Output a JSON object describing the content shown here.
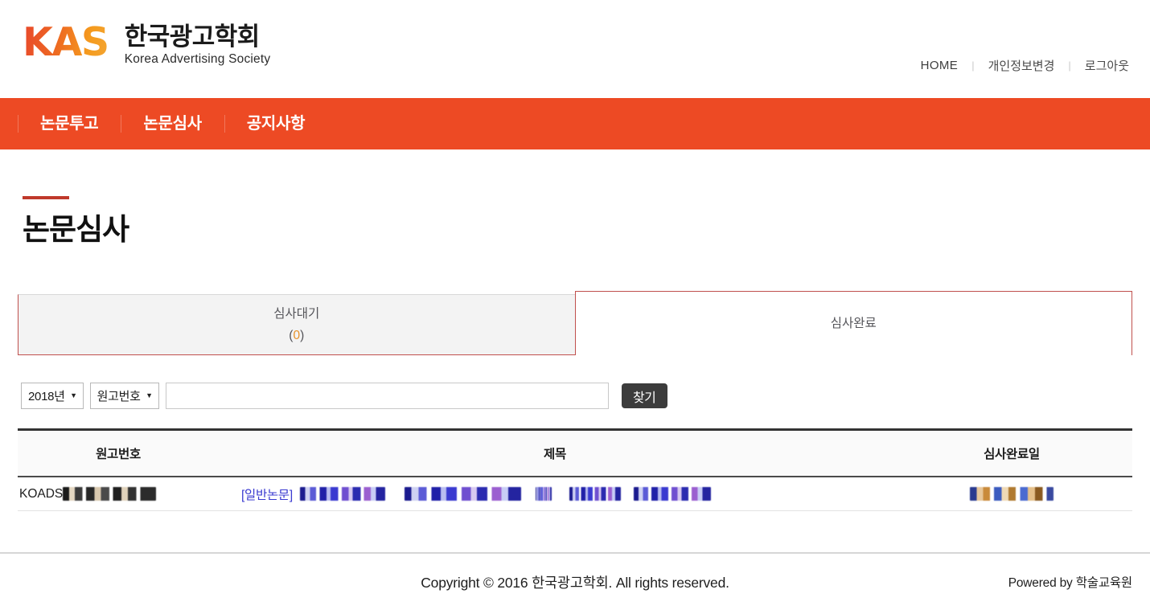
{
  "site": {
    "logo_mark": "KAS",
    "logo_name_ko": "한국광고학회",
    "logo_name_en": "Korea Advertising Society"
  },
  "top_nav": {
    "home": "HOME",
    "separator": "|",
    "profile": "개인정보변경",
    "logout": "로그아웃"
  },
  "main_nav": {
    "items": [
      {
        "label": "논문투고"
      },
      {
        "label": "논문심사"
      },
      {
        "label": "공지사항"
      }
    ]
  },
  "page": {
    "title": "논문심사"
  },
  "tabs": [
    {
      "label": "심사대기",
      "count_open": "(",
      "count": "0",
      "count_close": ")",
      "active": false
    },
    {
      "label": "심사완료",
      "active": true
    }
  ],
  "search": {
    "year_value": "2018년",
    "field_value": "원고번호",
    "caret": "▼",
    "keyword_value": "",
    "keyword_placeholder": "",
    "button_label": "찾기"
  },
  "table": {
    "headers": {
      "no": "원고번호",
      "title": "제목",
      "date": "심사완료일"
    },
    "rows": [
      {
        "no_prefix": "KOADS",
        "no_redacted": true,
        "title_tag": "[일반논문]",
        "title_redacted": true,
        "date_redacted": true
      }
    ]
  },
  "footer": {
    "copyright": "Copyright © 2016 한국광고학회. All rights reserved.",
    "powered": "Powered by 학술교육원"
  },
  "colors": {
    "brand_orange": "#ED4A24",
    "tab_border_red": "#C0504D",
    "title_rule_red": "#C0392B",
    "count_orange": "#E8932B",
    "link_blue": "#3A3AD0",
    "button_dark": "#3C3C3C"
  }
}
